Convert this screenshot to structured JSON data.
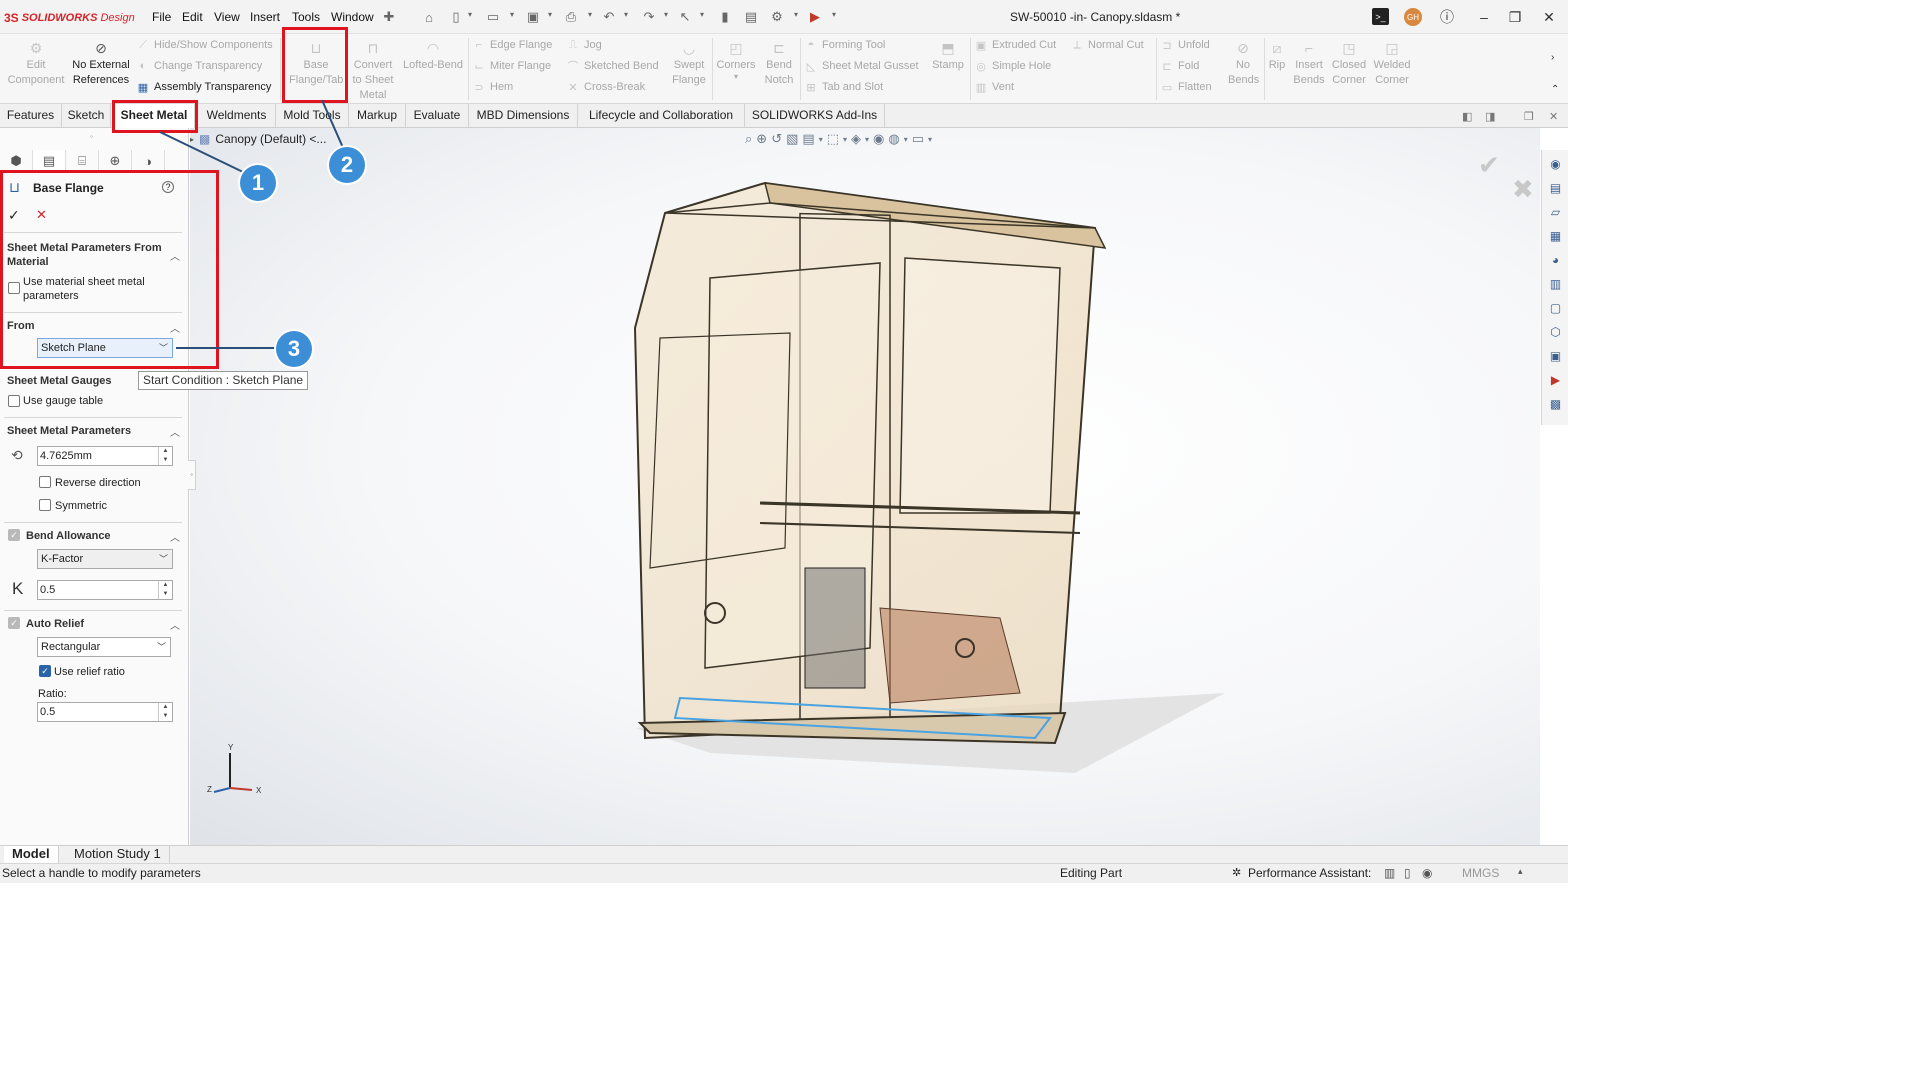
{
  "app": {
    "logo_ds": "3S",
    "logo_brand": "SOLIDWORKS",
    "logo_suffix": "Design",
    "document_title": "SW-50010 -in- Canopy.sldasm *",
    "avatar_initials": "GH",
    "accent_color": "#2b63a8",
    "annotation_color": "#e0141e",
    "callout_color": "#3c8fd6"
  },
  "menu": [
    "File",
    "Edit",
    "View",
    "Insert",
    "Tools",
    "Window"
  ],
  "ribbon": {
    "edit_component": "Edit Component",
    "no_external_references": "No External References",
    "hide_show_components": "Hide/Show Components",
    "change_transparency": "Change Transparency",
    "assembly_transparency": "Assembly Transparency",
    "base_flange_tab": "Base Flange/Tab",
    "convert_to_sheet_metal": "Convert to Sheet Metal",
    "lofted_bend": "Lofted-Bend",
    "edge_flange": "Edge Flange",
    "miter_flange": "Miter Flange",
    "hem": "Hem",
    "jog": "Jog",
    "sketched_bend": "Sketched Bend",
    "cross_break": "Cross-Break",
    "swept_flange": "Swept Flange",
    "corners": "Corners",
    "bend_notch": "Bend Notch",
    "forming_tool": "Forming Tool",
    "sheet_metal_gusset": "Sheet Metal Gusset",
    "tab_and_slot": "Tab and Slot",
    "stamp": "Stamp",
    "extruded_cut": "Extruded Cut",
    "simple_hole": "Simple Hole",
    "vent": "Vent",
    "normal_cut": "Normal Cut",
    "unfold": "Unfold",
    "fold": "Fold",
    "flatten": "Flatten",
    "no_bends": "No Bends",
    "rip": "Rip",
    "insert_bends": "Insert Bends",
    "closed_corner": "Closed Corner",
    "welded_corner": "Welded Corner"
  },
  "tabs": [
    "Features",
    "Sketch",
    "Sheet Metal",
    "Weldments",
    "Mold Tools",
    "Markup",
    "Evaluate",
    "MBD Dimensions",
    "Lifecycle and Collaboration",
    "SOLIDWORKS Add-Ins"
  ],
  "active_tab": "Sheet Metal",
  "tree": {
    "root_label": "Canopy (Default) <..."
  },
  "property_manager": {
    "title": "Base Flange",
    "help": "?",
    "section_material": "Sheet Metal Parameters From Material",
    "use_material_params": "Use material sheet metal parameters",
    "section_from": "From",
    "from_value": "Sketch Plane",
    "tooltip": "Start Condition : Sketch Plane",
    "section_gauges": "Sheet Metal Gauges",
    "use_gauge_table": "Use gauge table",
    "section_params": "Sheet Metal Parameters",
    "thickness": "4.7625mm",
    "reverse_direction": "Reverse direction",
    "symmetric": "Symmetric",
    "section_bend": "Bend Allowance",
    "bend_type": "K-Factor",
    "k_label": "K",
    "k_value": "0.5",
    "section_relief": "Auto Relief",
    "relief_type": "Rectangular",
    "use_relief_ratio": "Use relief ratio",
    "ratio_label": "Ratio:",
    "ratio_value": "0.5"
  },
  "callouts": [
    "1",
    "2",
    "3"
  ],
  "triad": {
    "y": "Y",
    "x": "X",
    "z": "Z"
  },
  "model_tabs": [
    "Model",
    "Motion Study 1"
  ],
  "status": {
    "message": "Select a handle to modify parameters",
    "editing": "Editing Part",
    "performance": "Performance Assistant:",
    "units": "MMGS"
  }
}
